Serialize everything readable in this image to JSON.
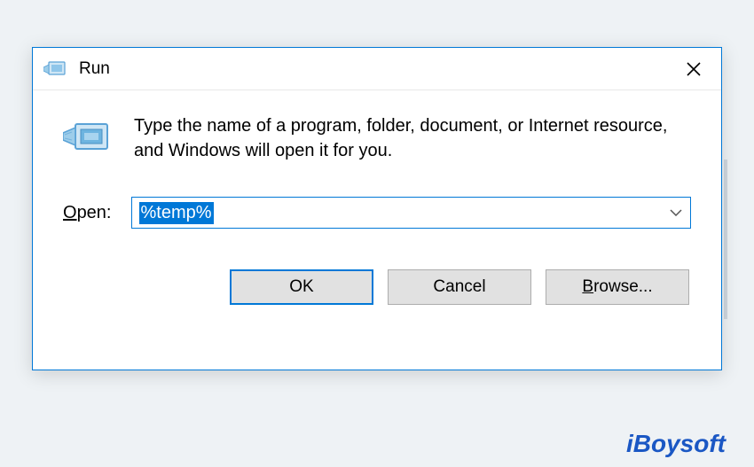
{
  "dialog": {
    "title": "Run",
    "description": "Type the name of a program, folder, document, or Internet resource, and Windows will open it for you.",
    "open_label_prefix": "O",
    "open_label_rest": "pen:",
    "input_value": "%temp%",
    "buttons": {
      "ok": "OK",
      "cancel": "Cancel",
      "browse_prefix": "B",
      "browse_rest": "rowse..."
    }
  },
  "watermark": "iBoysoft",
  "icons": {
    "run": "run-icon",
    "close": "close-icon",
    "chevron_down": "chevron-down-icon"
  },
  "colors": {
    "accent": "#0078d7",
    "button_bg": "#e1e1e1"
  }
}
